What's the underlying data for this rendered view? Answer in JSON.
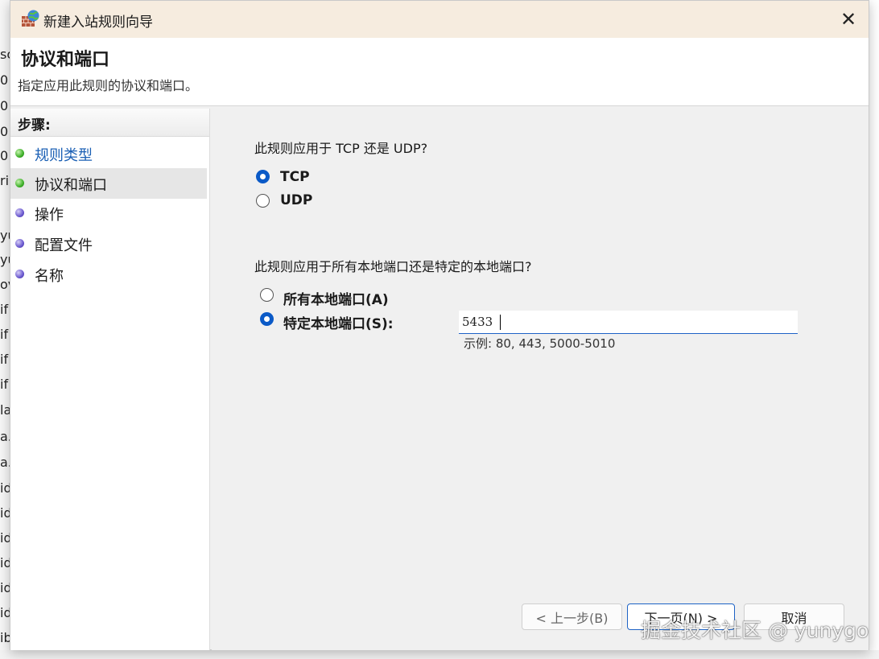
{
  "background_strip": [
    "sc",
    "0",
    "0",
    "0:",
    "0:",
    "ri",
    "yu",
    "yu",
    "ov",
    "if",
    "if",
    "if",
    "if",
    "la",
    "a.",
    "a.",
    "id",
    "id",
    "id",
    "id",
    "id",
    "id",
    "ib"
  ],
  "window": {
    "title": "新建入站规则向导",
    "icon": "firewall-globe-icon",
    "close_glyph": "✕"
  },
  "header": {
    "title": "协议和端口",
    "subtitle": "指定应用此规则的协议和端口。"
  },
  "sidebar": {
    "steps_label": "步骤:",
    "items": [
      {
        "label": "规则类型",
        "state": "done"
      },
      {
        "label": "协议和端口",
        "state": "current"
      },
      {
        "label": "操作",
        "state": "pending"
      },
      {
        "label": "配置文件",
        "state": "pending"
      },
      {
        "label": "名称",
        "state": "pending"
      }
    ]
  },
  "protocol": {
    "question": "此规则应用于 TCP 还是 UDP?",
    "options": [
      {
        "label": "TCP",
        "selected": true
      },
      {
        "label": "UDP",
        "selected": false
      }
    ]
  },
  "ports": {
    "question": "此规则应用于所有本地端口还是特定的本地端口?",
    "options": [
      {
        "label": "所有本地端口(A)",
        "selected": false
      },
      {
        "label": "特定本地端口(S):",
        "selected": true
      }
    ],
    "value": "5433",
    "example": "示例: 80, 443, 5000-5010"
  },
  "buttons": {
    "back": "< 上一步(B)",
    "next": "下一页(N) >",
    "cancel": "取消"
  },
  "watermark": "掘金技术社区 @ yunygo",
  "colors": {
    "accent": "#1e63c6",
    "title_bar": "#f6ecdf",
    "done_dot": "#3fb02a",
    "pending_dot": "#6a58cf"
  }
}
